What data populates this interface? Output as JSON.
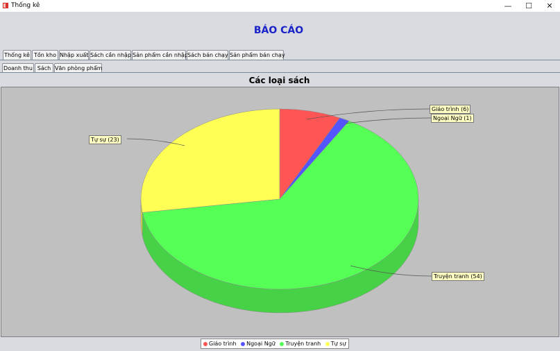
{
  "window": {
    "title": "Thống kê",
    "controls": {
      "minimize": "—",
      "maximize": "☐",
      "close": "✕"
    }
  },
  "header": {
    "title": "BÁO CÁO"
  },
  "main_tabs": [
    {
      "label": "Thống kê",
      "active": true
    },
    {
      "label": "Tồn kho",
      "active": false
    },
    {
      "label": "Nhập xuất",
      "active": false
    },
    {
      "label": "Sách cần nhập",
      "active": false
    },
    {
      "label": "Sản phẩm cần nhập",
      "active": false
    },
    {
      "label": "Sách bán chạy",
      "active": false
    },
    {
      "label": "Sản phẩm bán chạy",
      "active": false
    }
  ],
  "sub_tabs": [
    {
      "label": "Doanh thu",
      "active": false
    },
    {
      "label": "Sách",
      "active": true
    },
    {
      "label": "Văn phòng phẩm",
      "active": false
    }
  ],
  "chart_data": {
    "type": "pie",
    "title": "Các loại sách",
    "categories": [
      "Giáo trình",
      "Ngoại Ngữ",
      "Truyện tranh",
      "Tự sự"
    ],
    "values": [
      6,
      1,
      54,
      23
    ],
    "labels": [
      "Giáo trình (6)",
      "Ngoại Ngữ (1)",
      "Truyện tranh (54)",
      "Tự sự (23)"
    ],
    "colors": [
      "#ff5555",
      "#5555ff",
      "#55ff55",
      "#ffff55"
    ],
    "style": "3d",
    "legend_position": "bottom"
  }
}
